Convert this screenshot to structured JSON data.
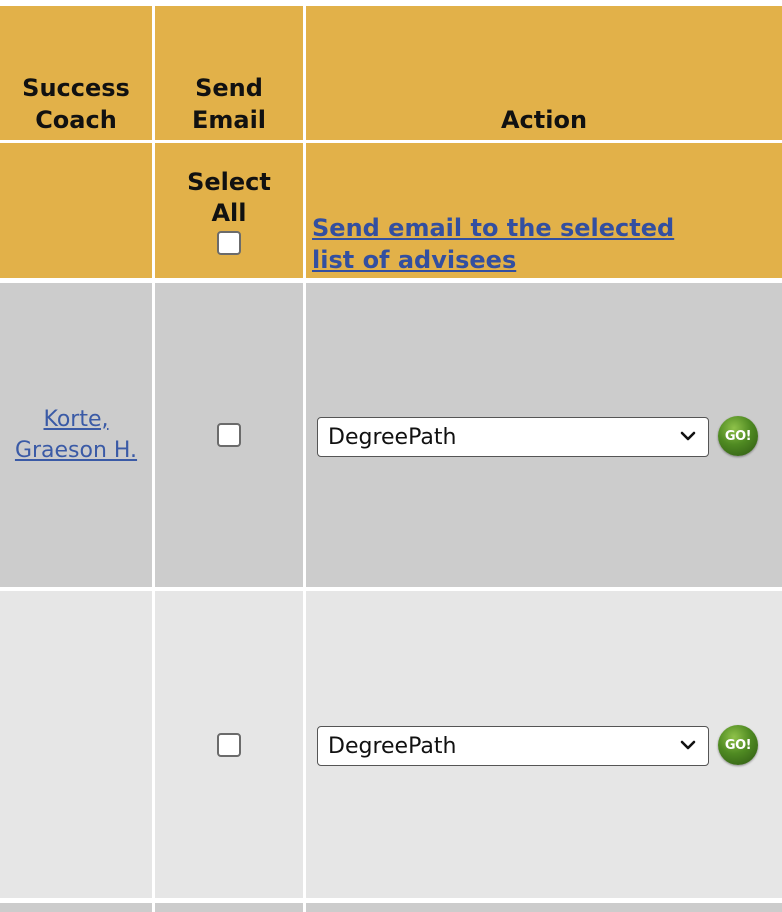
{
  "header": {
    "col_coach": "Success Coach",
    "col_email": "Send Email",
    "col_action": "Action"
  },
  "controls": {
    "select_all": "Select All",
    "send_email_link": "Send email to the selected list of advisees"
  },
  "rows": [
    {
      "coach": "Korte, Graeson H.",
      "action_selected": "DegreePath",
      "go_label": "GO!"
    },
    {
      "coach": "",
      "action_selected": "DegreePath",
      "go_label": "GO!"
    }
  ],
  "colors": {
    "header_bg": "#e2b149",
    "row_odd_bg": "#cccccc",
    "row_even_bg": "#e6e6e6",
    "link": "#334fa0",
    "go_button": "#4f8a22"
  },
  "icons": {
    "dropdown": "chevron-down-icon",
    "go": "go-button-icon"
  }
}
